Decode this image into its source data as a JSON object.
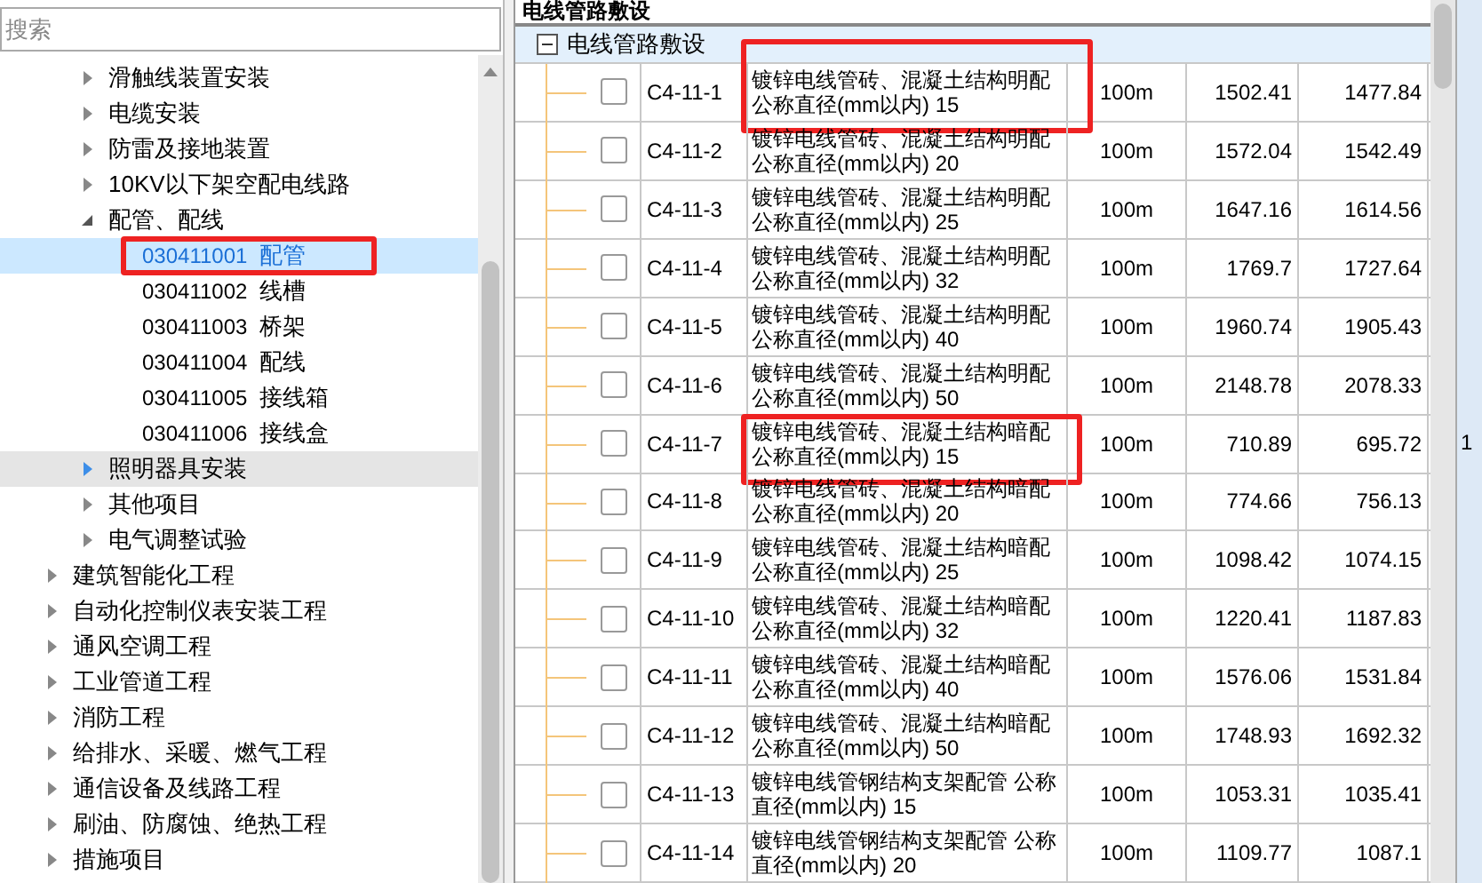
{
  "search": {
    "placeholder": "搜索"
  },
  "tree": [
    {
      "children": [
        {
          "label": "滑触线装置安装",
          "expanded": false,
          "hovered": false
        },
        {
          "label": "电缆安装",
          "expanded": false,
          "hovered": false
        },
        {
          "label": "防雷及接地装置",
          "expanded": false,
          "hovered": false
        },
        {
          "label": "10KV以下架空配电线路",
          "expanded": false,
          "hovered": false
        },
        {
          "label": "配管、配线",
          "expanded": true,
          "hovered": false,
          "children": [
            {
              "code": "030411001",
              "label": "配管",
              "selected": true,
              "marked": true
            },
            {
              "code": "030411002",
              "label": "线槽",
              "selected": false,
              "marked": false
            },
            {
              "code": "030411003",
              "label": "桥架",
              "selected": false,
              "marked": false
            },
            {
              "code": "030411004",
              "label": "配线",
              "selected": false,
              "marked": false
            },
            {
              "code": "030411005",
              "label": "接线箱",
              "selected": false,
              "marked": false
            },
            {
              "code": "030411006",
              "label": "接线盒",
              "selected": false,
              "marked": false
            }
          ]
        },
        {
          "label": "照明器具安装",
          "expanded": false,
          "hovered": true
        },
        {
          "label": "其他项目",
          "expanded": false,
          "hovered": false
        },
        {
          "label": "电气调整试验",
          "expanded": false,
          "hovered": false
        }
      ]
    },
    {
      "label": "建筑智能化工程",
      "expanded": false,
      "hovered": false
    },
    {
      "label": "自动化控制仪表安装工程",
      "expanded": false,
      "hovered": false
    },
    {
      "label": "通风空调工程",
      "expanded": false,
      "hovered": false
    },
    {
      "label": "工业管道工程",
      "expanded": false,
      "hovered": false
    },
    {
      "label": "消防工程",
      "expanded": false,
      "hovered": false
    },
    {
      "label": "给排水、采暖、燃气工程",
      "expanded": false,
      "hovered": false
    },
    {
      "label": "通信设备及线路工程",
      "expanded": false,
      "hovered": false
    },
    {
      "label": "刷油、防腐蚀、绝热工程",
      "expanded": false,
      "hovered": false
    },
    {
      "label": "措施项目",
      "expanded": false,
      "hovered": false
    }
  ],
  "table": {
    "parent_group": "电线管路敷设",
    "group": {
      "label": "电线管路敷设",
      "expanded": true
    },
    "rows": [
      {
        "checked": false,
        "marked": true,
        "code": "C4-11-1",
        "name": [
          "镀锌电线管砖、混凝土结构明配",
          "公称直径(mm以内) 15"
        ],
        "unit": "100m",
        "price_1": "1502.41",
        "price_2": "1477.84"
      },
      {
        "checked": false,
        "marked": false,
        "code": "C4-11-2",
        "name": [
          "镀锌电线管砖、混凝土结构明配",
          "公称直径(mm以内) 20"
        ],
        "unit": "100m",
        "price_1": "1572.04",
        "price_2": "1542.49"
      },
      {
        "checked": false,
        "marked": false,
        "code": "C4-11-3",
        "name": [
          "镀锌电线管砖、混凝土结构明配",
          "公称直径(mm以内) 25"
        ],
        "unit": "100m",
        "price_1": "1647.16",
        "price_2": "1614.56"
      },
      {
        "checked": false,
        "marked": false,
        "code": "C4-11-4",
        "name": [
          "镀锌电线管砖、混凝土结构明配",
          "公称直径(mm以内) 32"
        ],
        "unit": "100m",
        "price_1": "1769.7",
        "price_2": "1727.64"
      },
      {
        "checked": false,
        "marked": false,
        "code": "C4-11-5",
        "name": [
          "镀锌电线管砖、混凝土结构明配",
          "公称直径(mm以内) 40"
        ],
        "unit": "100m",
        "price_1": "1960.74",
        "price_2": "1905.43"
      },
      {
        "checked": false,
        "marked": false,
        "code": "C4-11-6",
        "name": [
          "镀锌电线管砖、混凝土结构明配",
          "公称直径(mm以内) 50"
        ],
        "unit": "100m",
        "price_1": "2148.78",
        "price_2": "2078.33"
      },
      {
        "checked": false,
        "marked": true,
        "code": "C4-11-7",
        "name": [
          "镀锌电线管砖、混凝土结构暗配",
          "公称直径(mm以内) 15"
        ],
        "unit": "100m",
        "price_1": "710.89",
        "price_2": "695.72"
      },
      {
        "checked": false,
        "marked": false,
        "code": "C4-11-8",
        "name": [
          "镀锌电线管砖、混凝土结构暗配",
          "公称直径(mm以内) 20"
        ],
        "unit": "100m",
        "price_1": "774.66",
        "price_2": "756.13"
      },
      {
        "checked": false,
        "marked": false,
        "code": "C4-11-9",
        "name": [
          "镀锌电线管砖、混凝土结构暗配",
          "公称直径(mm以内) 25"
        ],
        "unit": "100m",
        "price_1": "1098.42",
        "price_2": "1074.15"
      },
      {
        "checked": false,
        "marked": false,
        "code": "C4-11-10",
        "name": [
          "镀锌电线管砖、混凝土结构暗配",
          "公称直径(mm以内) 32"
        ],
        "unit": "100m",
        "price_1": "1220.41",
        "price_2": "1187.83"
      },
      {
        "checked": false,
        "marked": false,
        "code": "C4-11-11",
        "name": [
          "镀锌电线管砖、混凝土结构暗配",
          "公称直径(mm以内) 40"
        ],
        "unit": "100m",
        "price_1": "1576.06",
        "price_2": "1531.84"
      },
      {
        "checked": false,
        "marked": false,
        "code": "C4-11-12",
        "name": [
          "镀锌电线管砖、混凝土结构暗配",
          "公称直径(mm以内) 50"
        ],
        "unit": "100m",
        "price_1": "1748.93",
        "price_2": "1692.32"
      },
      {
        "checked": false,
        "marked": false,
        "code": "C4-11-13",
        "name": [
          "镀锌电线管钢结构支架配管 公称",
          "直径(mm以内) 15"
        ],
        "unit": "100m",
        "price_1": "1053.31",
        "price_2": "1035.41"
      },
      {
        "checked": false,
        "marked": false,
        "code": "C4-11-14",
        "name": [
          "镀锌电线管钢结构支架配管 公称",
          "直径(mm以内) 20"
        ],
        "unit": "100m",
        "price_1": "1109.77",
        "price_2": "1087.1"
      }
    ]
  },
  "side_panel": {
    "text": "1"
  }
}
